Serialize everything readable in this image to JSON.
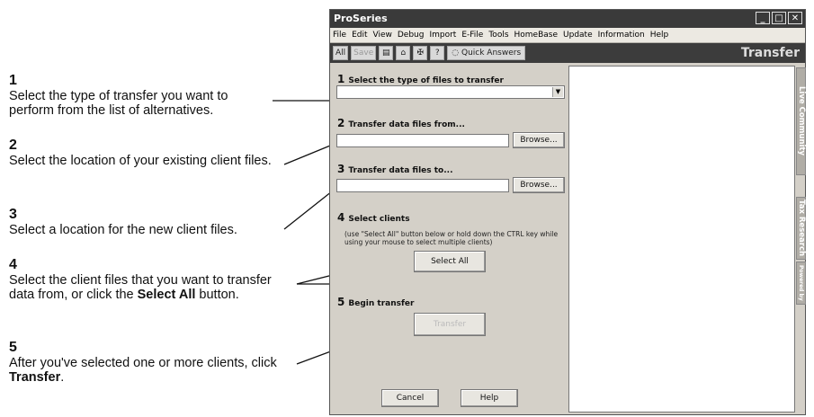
{
  "annotations": [
    {
      "num": "1",
      "text": "Select the type of transfer you want to perform from the list of alternatives."
    },
    {
      "num": "2",
      "text": "Select the location of your existing client files."
    },
    {
      "num": "3",
      "text": "Select a location for the new client files."
    },
    {
      "num": "4",
      "text_a": "Select the client files that you want to transfer data from, or click the ",
      "bold": "Select All",
      "text_b": " button."
    },
    {
      "num": "5",
      "text_a": "After you've selected one or more clients, click ",
      "bold": "Transfer",
      "text_b": "."
    }
  ],
  "window": {
    "title": "ProSeries",
    "menu": [
      "File",
      "Edit",
      "View",
      "Debug",
      "Import",
      "E-File",
      "Tools",
      "HomeBase",
      "Update",
      "Information",
      "Help"
    ],
    "toolbar": {
      "all": "All",
      "save": "Save",
      "quick_answers": "Quick Answers",
      "title": "Transfer"
    },
    "steps": {
      "s1": {
        "num": "1",
        "label": "Select the type of files to transfer"
      },
      "s2": {
        "num": "2",
        "label": "Transfer data files from...",
        "browse": "Browse..."
      },
      "s3": {
        "num": "3",
        "label": "Transfer data files to...",
        "browse": "Browse..."
      },
      "s4": {
        "num": "4",
        "label": "Select clients",
        "note": "(use \"Select All\" button below or hold down the CTRL key while using your mouse to select multiple clients)",
        "select_all": "Select All"
      },
      "s5": {
        "num": "5",
        "label": "Begin transfer",
        "transfer": "Transfer"
      }
    },
    "cancel": "Cancel",
    "help": "Help",
    "side_tabs": {
      "live": "Live Community",
      "tax": "Tax Research",
      "powered": "Powered by"
    }
  }
}
